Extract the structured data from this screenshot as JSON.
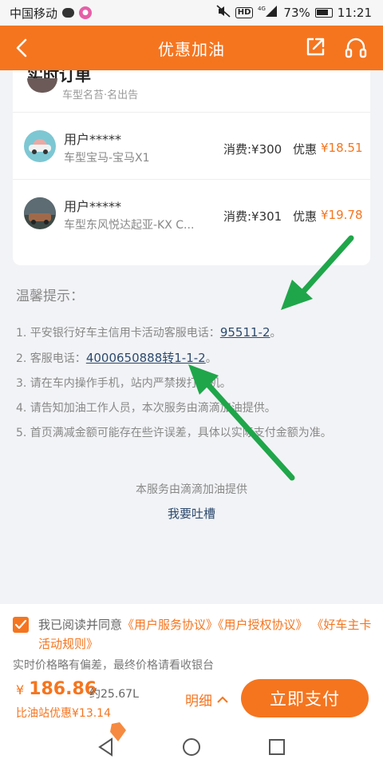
{
  "status_bar": {
    "carrier": "中国移动",
    "network": "4G",
    "hd": "HD",
    "battery": "73%",
    "time": "11:21"
  },
  "nav": {
    "title": "优惠加油"
  },
  "orders": {
    "partial_title": "实时订单",
    "partial_row": "车型名苔·名出告",
    "rows": [
      {
        "user": "用户*****",
        "car": "车型宝马-宝马X1",
        "spend": "消费:¥300",
        "discount_label": "优惠",
        "discount": "¥18.51"
      },
      {
        "user": "用户*****",
        "car": "车型东风悦达起亚-KX C...",
        "spend": "消费:¥301",
        "discount_label": "优惠",
        "discount": "¥19.78"
      }
    ]
  },
  "tips": {
    "heading": "温馨提示：",
    "t1_prefix": "1. 平安银行好车主信用卡活动客服电话：",
    "t1_link": "95511-2",
    "t1_suffix": "。",
    "t2_prefix": "2. 客服电话：",
    "t2_link": "4000650888转1-1-2",
    "t2_suffix": "。",
    "t3": "3. 请在车内操作手机，站内严禁拨打手机。",
    "t4": "4. 请告知加油工作人员，本次服务由滴滴加油提供。",
    "t5": "5. 首页满减金额可能存在些许误差，具体以实际支付金额为准。",
    "provider": "本服务由滴滴加油提供",
    "feedback": "我要吐槽"
  },
  "bottom": {
    "agree_prefix": "我已阅读并同意",
    "agree_link1": "《用户服务协议》",
    "agree_link2": "《用户授权协议》",
    "agree_link3": "《好车主卡活动规则》",
    "price_note": "实时价格略有偏差，最终价格请看收银台",
    "currency": "¥",
    "price": "186.86",
    "liters": "约25.67L",
    "savings": "比油站优惠¥13.14",
    "detail": "明细",
    "pay": "立即支付"
  },
  "colors": {
    "accent": "#f5751f",
    "link": "#2d4a6e",
    "arrow": "#1fa64a"
  }
}
